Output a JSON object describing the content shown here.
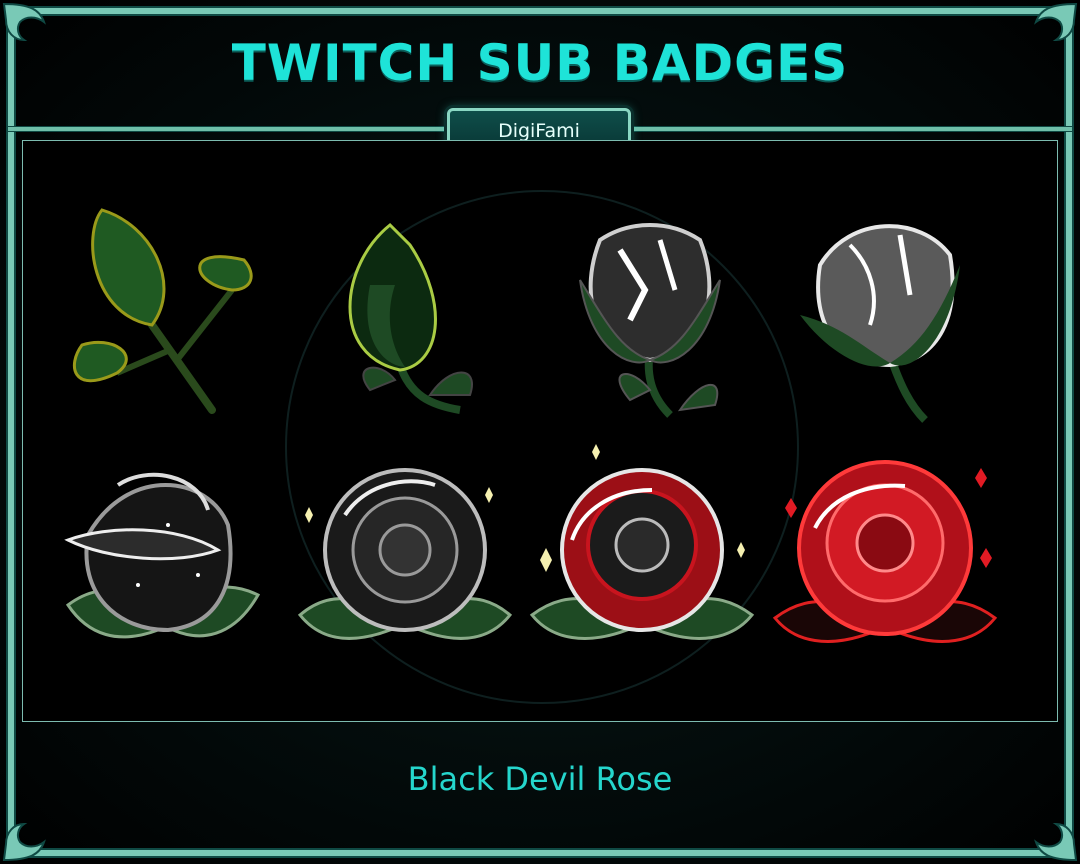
{
  "header": {
    "title": "TWITCH SUB BADGES",
    "brand": "DigiFami"
  },
  "badges": [
    {
      "icon": "rose-leaves-icon"
    },
    {
      "icon": "green-rosebud-icon"
    },
    {
      "icon": "dark-rosebud-icon"
    },
    {
      "icon": "silver-rosebud-icon"
    },
    {
      "icon": "black-rose-icon"
    },
    {
      "icon": "black-rose-sparkle-icon"
    },
    {
      "icon": "black-red-rose-icon"
    },
    {
      "icon": "red-rose-icon"
    }
  ],
  "footer": {
    "caption": "Black Devil Rose"
  },
  "colors": {
    "accent": "#1ee3d8",
    "frame": "#79c9b6",
    "leaf": "#1e4a24",
    "rose_red": "#c8141e",
    "rose_black": "#2a2a2a"
  }
}
